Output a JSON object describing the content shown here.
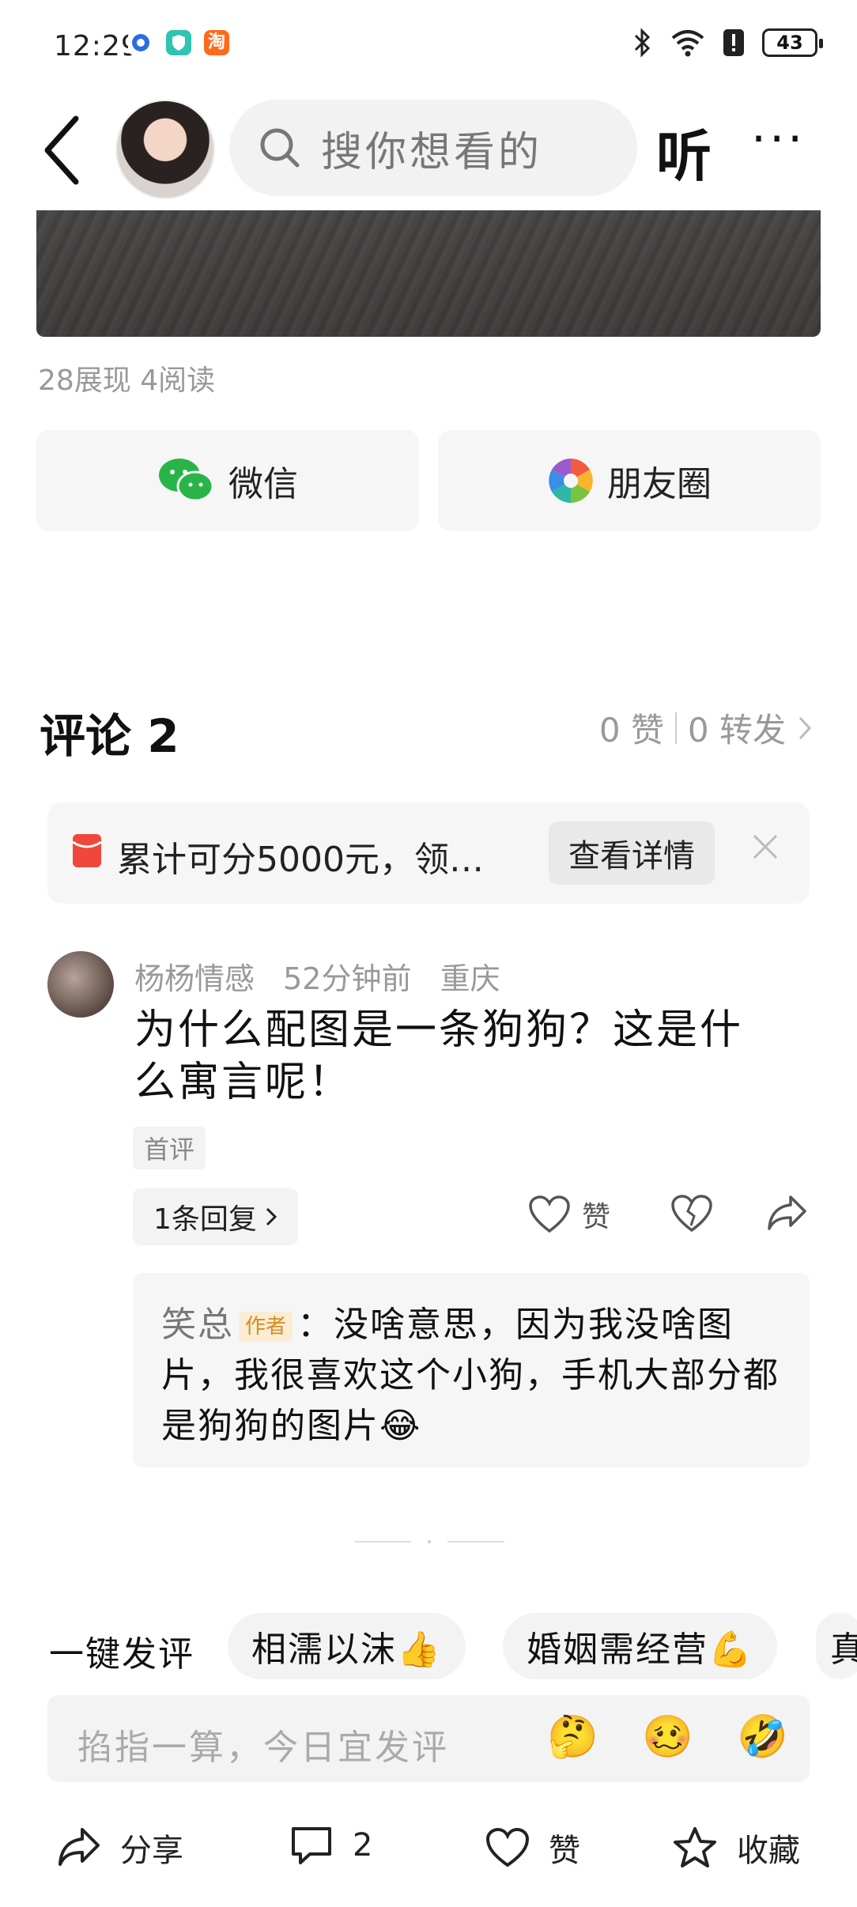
{
  "status_bar": {
    "time": "12:29",
    "battery": "43",
    "app_icons": [
      "circle-dot-icon",
      "shield-icon",
      "taobao-icon"
    ],
    "taobao_label": "淘"
  },
  "header": {
    "search_placeholder": "搜你想看的",
    "listen_label": "听",
    "more_label": "···"
  },
  "article": {
    "stats": "28展现  4阅读"
  },
  "share": {
    "wechat_label": "微信",
    "moments_label": "朋友圈"
  },
  "comments": {
    "title": "评论 2",
    "likes": "0 赞",
    "forwards": "0 转发",
    "promo": {
      "text": "累计可分5000元，领…",
      "button": "查看详情"
    },
    "items": [
      {
        "user": "杨杨情感",
        "time": "52分钟前",
        "location": "重庆",
        "text": "为什么配图是一条狗狗？这是什么寓言呢！",
        "badge": "首评",
        "reply_count": "1条回复",
        "like_label": "赞",
        "reply": {
          "name": "笑总",
          "tag": "作者",
          "text": "：没啥意思，因为我没啥图片，我很喜欢这个小狗，手机大部分都是狗狗的图片😂"
        }
      }
    ]
  },
  "composer": {
    "quick_label": "一键发评",
    "chips": [
      "相濡以沫👍",
      "婚姻需经营💪",
      "真"
    ],
    "placeholder": "掐指一算，今日宜发评",
    "emojis": [
      "🤔",
      "🥴",
      "🤣"
    ]
  },
  "bottom_bar": {
    "share": "分享",
    "comments": "2",
    "like": "赞",
    "favorite": "收藏"
  }
}
